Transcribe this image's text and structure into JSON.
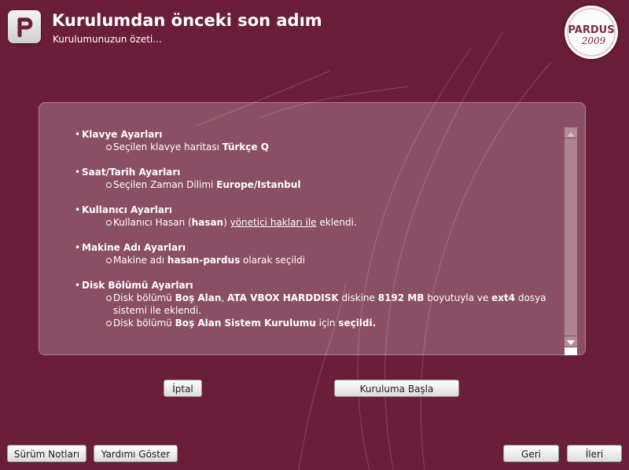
{
  "header": {
    "title": "Kurulumdan önceki son adım",
    "subtitle": "Kurulumunuzun özeti...",
    "logo_icon": "pardus-p-icon",
    "brand": {
      "name": "PARDUS",
      "year": "2009"
    }
  },
  "summary": {
    "sections": [
      {
        "heading": "Klavye Ayarları",
        "items": [
          {
            "parts": [
              {
                "text": "Seçilen klavye haritası "
              },
              {
                "text": "Türkçe Q",
                "bold": true
              }
            ]
          }
        ]
      },
      {
        "heading": "Saat/Tarih Ayarları",
        "items": [
          {
            "parts": [
              {
                "text": "Seçilen Zaman Dilimi "
              },
              {
                "text": "Europe/Istanbul",
                "bold": true
              }
            ]
          }
        ]
      },
      {
        "heading": "Kullanıcı Ayarları",
        "items": [
          {
            "parts": [
              {
                "text": "Kullanıcı Hasan ("
              },
              {
                "text": "hasan",
                "bold": true
              },
              {
                "text": ") "
              },
              {
                "text": "yönetici hakları ile",
                "underline": true
              },
              {
                "text": " eklendi."
              }
            ]
          }
        ]
      },
      {
        "heading": "Makine Adı Ayarları",
        "items": [
          {
            "parts": [
              {
                "text": "Makine adı "
              },
              {
                "text": "hasan-pardus",
                "bold": true
              },
              {
                "text": " olarak seçildi"
              }
            ]
          }
        ]
      },
      {
        "heading": "Disk Bölümü Ayarları",
        "items": [
          {
            "parts": [
              {
                "text": "Disk bölümü "
              },
              {
                "text": "Boş Alan",
                "bold": true
              },
              {
                "text": ", "
              },
              {
                "text": "ATA VBOX HARDDISK",
                "bold": true
              },
              {
                "text": " diskine "
              },
              {
                "text": "8192 MB",
                "bold": true
              },
              {
                "text": " boyutuyla ve "
              },
              {
                "text": "ext4",
                "bold": true
              },
              {
                "text": " dosya sistemi ile eklendi."
              }
            ]
          },
          {
            "parts": [
              {
                "text": "Disk bölümü "
              },
              {
                "text": "Boş Alan Sistem Kurulumu",
                "bold": true
              },
              {
                "text": " için "
              },
              {
                "text": "seçildi.",
                "bold": true
              }
            ]
          }
        ]
      }
    ]
  },
  "actions": {
    "cancel_label": "İptal",
    "start_label": "Kuruluma Başla"
  },
  "footer": {
    "release_notes_label": "Sürüm Notları",
    "help_label": "Yardımı Göster",
    "back_label": "Geri",
    "next_label": "İleri"
  },
  "colors": {
    "background": "#6b1e3a",
    "panel": "rgba(255,255,255,0.22)",
    "text": "#ffffff"
  }
}
